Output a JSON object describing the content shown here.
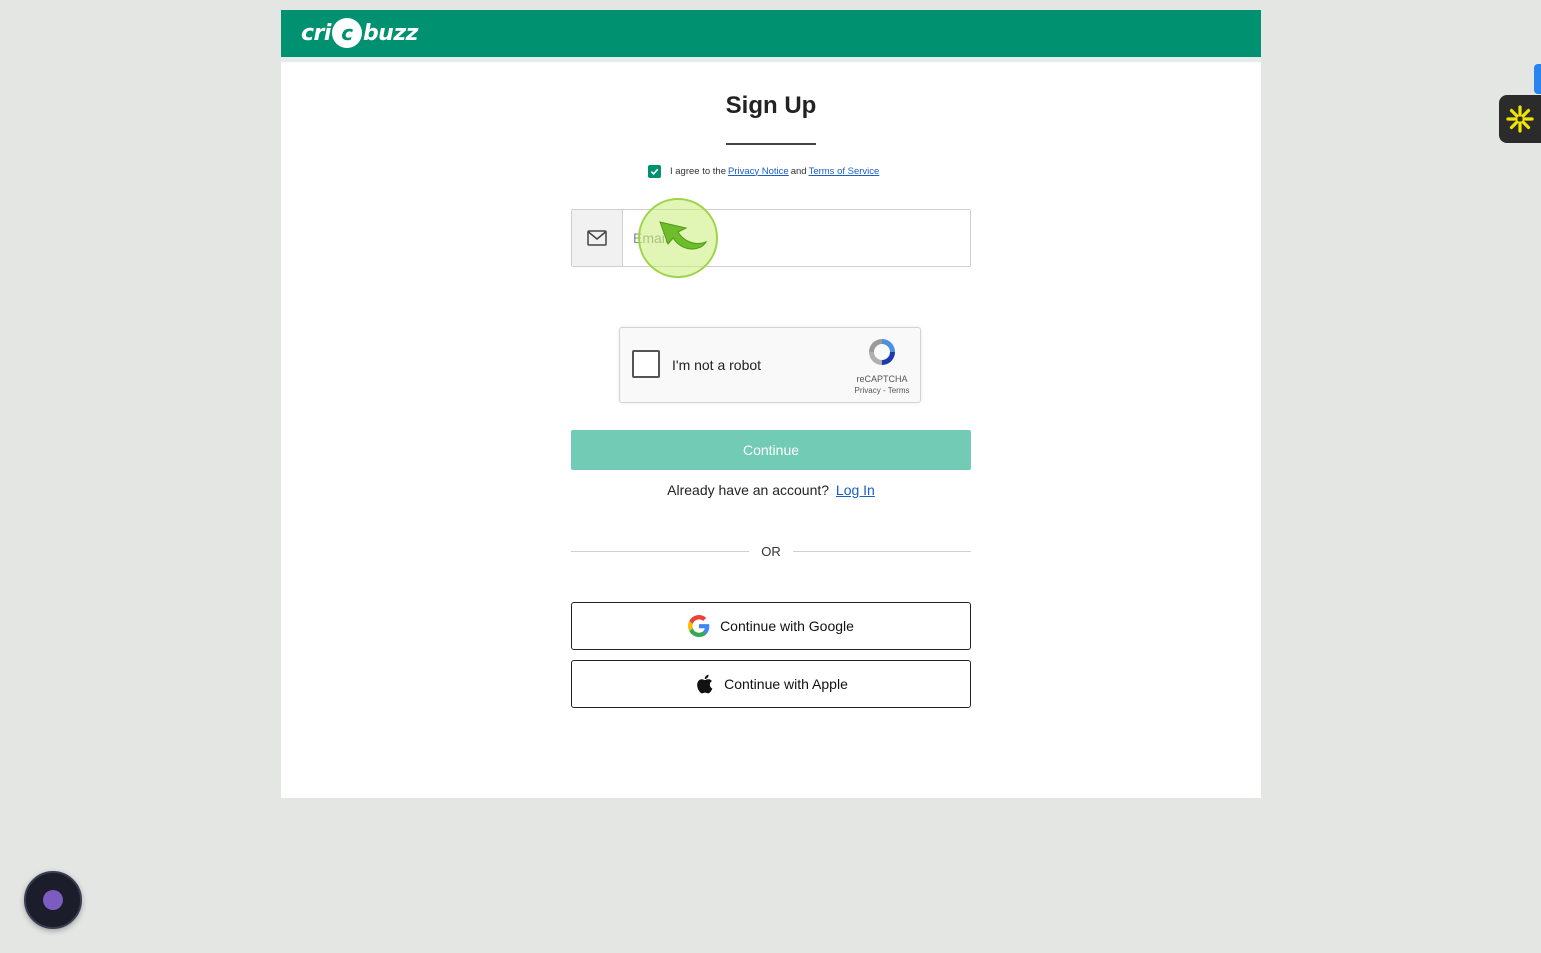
{
  "header": {
    "logo_pre": "cri",
    "logo_ball": "c",
    "logo_post": "buzz",
    "bg_color": "#009270"
  },
  "signup": {
    "title": "Sign Up",
    "agree_checked": true,
    "agree_text_pre": "I agree to the",
    "privacy_link": "Privacy Notice",
    "agree_and": "and",
    "terms_link": "Terms of Service",
    "email_placeholder": "Email",
    "email_icon": "envelope-icon",
    "continue_label": "Continue",
    "continue_color": "#72cbb5",
    "have_account_text": "Already have an account?",
    "login_link": "Log In",
    "or_text": "OR",
    "google_label": "Continue with Google",
    "apple_label": "Continue with Apple"
  },
  "captcha": {
    "label": "I'm not a robot",
    "brand": "reCAPTCHA",
    "privacy": "Privacy",
    "separator": "-",
    "terms": "Terms"
  },
  "overlays": {
    "side_widget_icon": "asterisk-icon",
    "record_button_icon": "record-dot-icon",
    "cursor_icon": "cursor-arrow-icon"
  }
}
